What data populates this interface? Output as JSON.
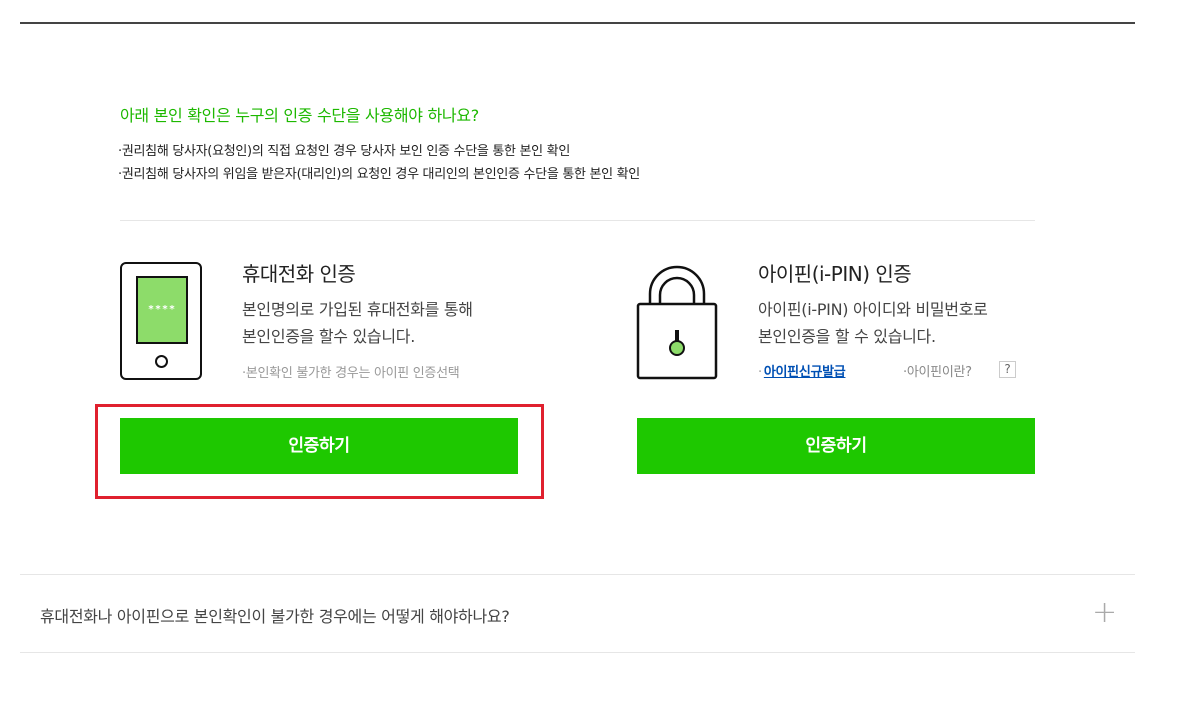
{
  "question": "아래 본인 확인은 누구의 인증 수단을 사용해야 하나요?",
  "bullets": [
    "권리침해 당사자(요청인)의 직접 요청인 경우 당사자 보인 인증 수단을 통한 본인 확인",
    "권리침해 당사자의 위임을 받은자(대리인)의 요청인 경우 대리인의 본인인증 수단을 통한 본인 확인"
  ],
  "phone": {
    "title": "휴대전화 인증",
    "desc_line1": "본인명의로 가입된 휴대전화를 통해",
    "desc_line2": "본인인증을 할수 있습니다.",
    "note": "본인확인 불가한 경우는 아이핀 인증선택",
    "screen_text": "****",
    "button_label": "인증하기"
  },
  "ipin": {
    "title": "아이핀(i-PIN) 인증",
    "desc_line1": "아이핀(i-PIN) 아이디와 비밀번호로",
    "desc_line2": "본인인증을 할 수 있습니다.",
    "link_new": "아이핀신규발급",
    "link_what": "아이핀이란?",
    "help": "?",
    "button_label": "인증하기"
  },
  "faq": {
    "question": "휴대전화나 아이핀으로 본인확인이 불가한 경우에는 어떻게 해야하나요?",
    "expand": "+"
  },
  "icons": {
    "phone": "mobile-phone-icon",
    "lock": "padlock-icon",
    "plus": "plus-icon"
  },
  "colors": {
    "accent_green": "#1ec800",
    "question_green": "#1db800",
    "highlight_red": "#e0202e",
    "link_blue": "#0050b4"
  }
}
